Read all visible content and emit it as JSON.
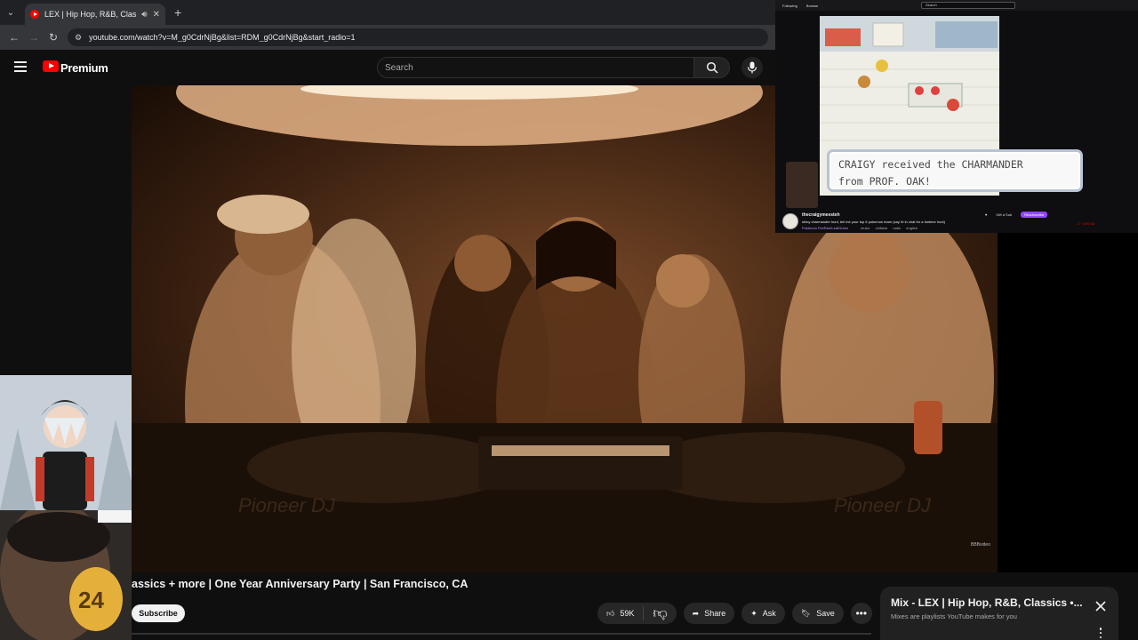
{
  "browser": {
    "tab_title": "LEX | Hip Hop, R&B, Classic",
    "tab_audio_icon": "speaker-icon",
    "url": "youtube.com/watch?v=M_g0CdrNjBg&list=RDM_g0CdrNjBg&start_radio=1"
  },
  "youtube": {
    "brand": "Premium",
    "search_placeholder": "Search",
    "video_title": "assics + more | One Year Anniversary Party | San Francisco, CA",
    "subscribe_label": "Subscribe",
    "like_count": "59K",
    "share_label": "Share",
    "ask_label": "Ask",
    "save_label": "Save",
    "watermark": "BBBvideo",
    "colors": {
      "brand_red": "#ff0000",
      "background": "#0f0f0f",
      "pill": "#272727"
    }
  },
  "mix_panel": {
    "title": "Mix - LEX | Hip Hop, R&B, Classics •...",
    "subtitle": "Mixes are playlists YouTube makes for you"
  },
  "stream": {
    "top_links": [
      "Following",
      "Browse"
    ],
    "search_placeholder": "Search",
    "dialog_line1": "CRAIGY received the CHARMANDER",
    "dialog_line2": "from PROF. OAK!",
    "channel_name": "thecraigymeesteh",
    "stream_title": "shiny charmander hunt, tell me your top 6 pokemon team (say !rt in chat for a funtime hunt)",
    "category": "Pokémon FireRed/LeafGreen",
    "tags": [
      "music",
      "chillstar",
      "radio",
      "english"
    ],
    "actions": [
      "Gift a Sub",
      "Resubscribe"
    ],
    "viewers": "3 · 3:00:42",
    "colors": {
      "purple": "#9147ff",
      "dialog_border": "#b9c3d6"
    }
  },
  "avatar_overlay": {
    "jersey_number": "24"
  }
}
